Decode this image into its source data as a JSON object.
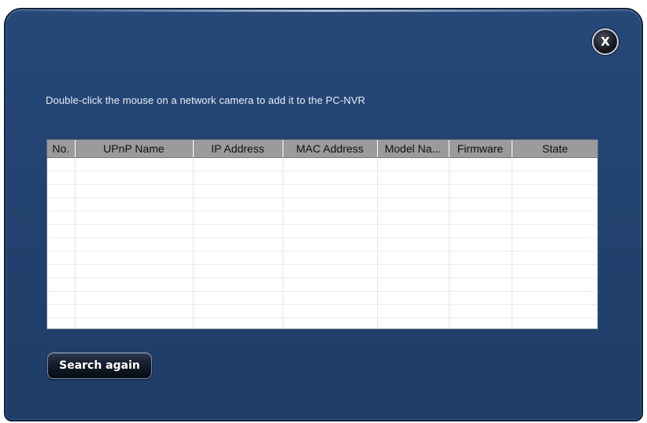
{
  "dialog": {
    "close_label": "X",
    "instruction": "Double-click the mouse on a network camera to add it to the PC-NVR",
    "search_button_label": "Search again"
  },
  "camera_table": {
    "columns": [
      "No.",
      "UPnP Name",
      "IP Address",
      "MAC Address",
      "Model Na...",
      "Firmware",
      "State"
    ],
    "rows": []
  },
  "colors": {
    "dialog_background": "#22426f",
    "header_background": "#9b9b9b",
    "button_background": "#141c2c"
  },
  "icons": {
    "close": "close-icon"
  }
}
